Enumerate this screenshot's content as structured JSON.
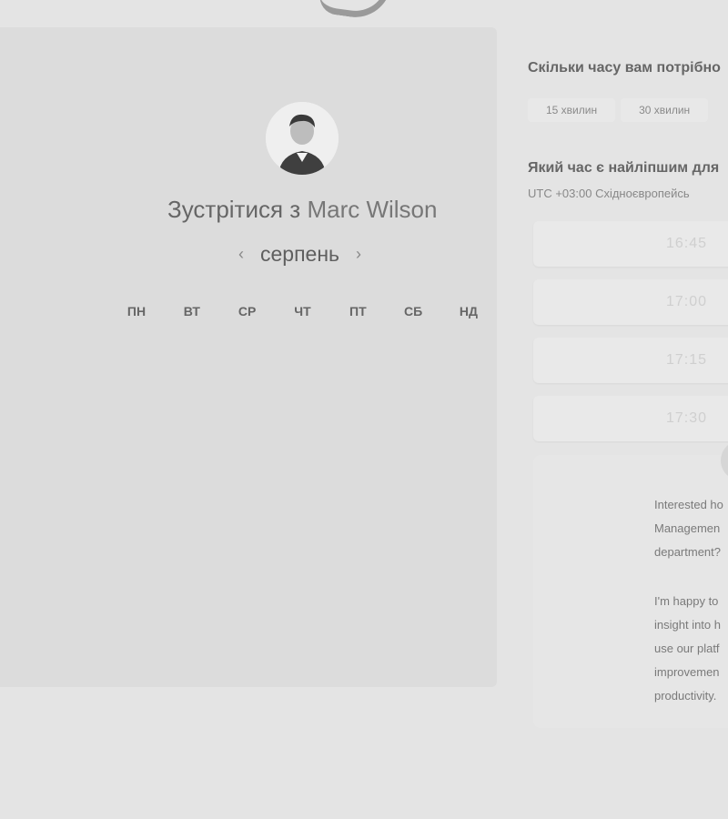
{
  "meeting": {
    "title_prefix": "Зустрітися з",
    "host_name": "Marc Wilson",
    "month": "серпень",
    "weekdays": [
      "ПН",
      "ВТ",
      "СР",
      "ЧТ",
      "ПТ",
      "СБ",
      "НД"
    ]
  },
  "duration": {
    "question": "Скільки часу вам потрібно",
    "options": [
      "15 хвилин",
      "30 хвилин"
    ]
  },
  "time": {
    "question": "Який час є найліпшим для",
    "timezone": "UTC +03:00 Східноєвропейсь",
    "slots": [
      "16:45",
      "17:00",
      "17:15",
      "17:30"
    ]
  },
  "info": {
    "para1_lines": [
      "Interested ho",
      "Managemen",
      "department?"
    ],
    "para2_lines": [
      "I'm happy to",
      "insight into h",
      "use our platf",
      "improvemen",
      "productivity."
    ]
  }
}
